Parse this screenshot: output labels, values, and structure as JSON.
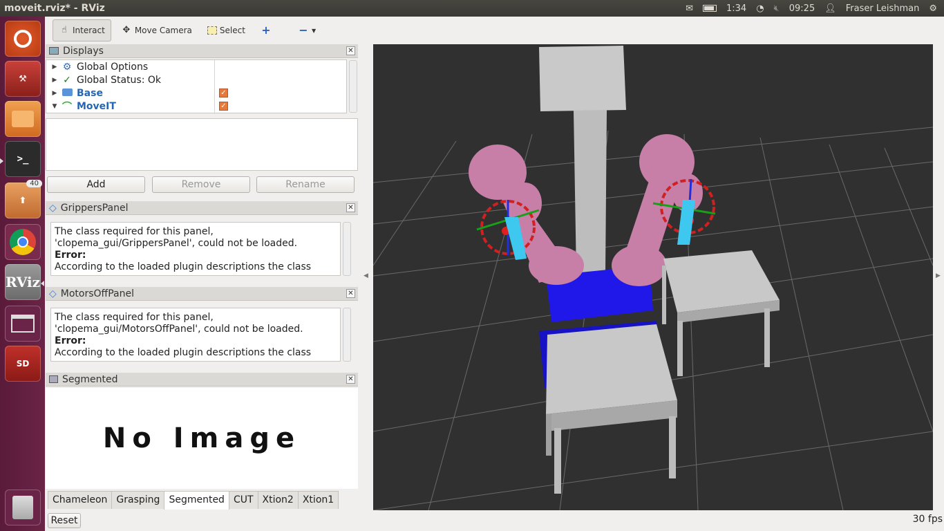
{
  "topbar": {
    "title": "moveit.rviz* - RViz",
    "battery": "1:34",
    "time": "09:25",
    "user": "Fraser Leishman"
  },
  "launcher": {
    "badge": "40",
    "rviz_label": "RViz",
    "sd_label": "SD"
  },
  "toolbar": {
    "interact": "Interact",
    "move_camera": "Move Camera",
    "select": "Select"
  },
  "displays": {
    "title": "Displays",
    "items": [
      {
        "label": "Global Options",
        "icon": "gear-icon",
        "expanded": false
      },
      {
        "label": "Global Status: Ok",
        "icon": "check-icon",
        "expanded": false
      },
      {
        "label": "Base",
        "icon": "folder-icon",
        "expanded": false,
        "checked": true
      },
      {
        "label": "MoveIT",
        "icon": "moveit-icon",
        "expanded": true,
        "checked": true
      }
    ],
    "buttons": {
      "add": "Add",
      "remove": "Remove",
      "rename": "Rename"
    }
  },
  "grippers_panel": {
    "title": "GrippersPanel",
    "line1": "The class required for this panel,",
    "line2": "'clopema_gui/GrippersPanel', could not be loaded.",
    "line3": "Error:",
    "line4": "According to the loaded plugin descriptions the class"
  },
  "motors_panel": {
    "title": "MotorsOffPanel",
    "line1": "The class required for this panel,",
    "line2": "'clopema_gui/MotorsOffPanel', could not be loaded.",
    "line3": "Error:",
    "line4": "According to the loaded plugin descriptions the class"
  },
  "segmented": {
    "title": "Segmented",
    "image_text": "No Image"
  },
  "tabs": [
    "Chameleon",
    "Grasping",
    "Segmented",
    "CUT",
    "Xtion2",
    "Xtion1"
  ],
  "selected_tab": "Segmented",
  "bottom": {
    "reset": "Reset",
    "fps": "30 fps"
  },
  "colors": {
    "launcher": "#5e1e3e",
    "robot": "#c77fa7",
    "base": "#1f18e8",
    "grid_bg": "#303030",
    "checkbox": "#e67a3d"
  }
}
